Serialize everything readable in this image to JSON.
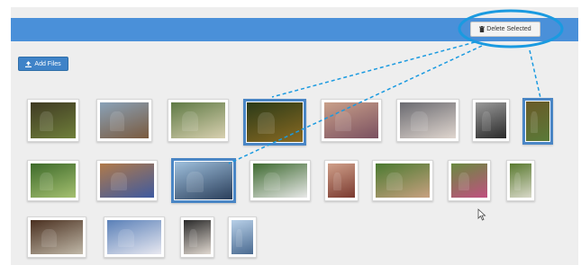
{
  "toolbar": {
    "delete_label": "Delete Selected",
    "delete_icon": "trash-icon",
    "add_label": "Add Files",
    "add_icon": "upload-icon"
  },
  "colors": {
    "accent": "#4a90d9",
    "selection_border": "#4a86c5",
    "callout": "#1a9ae0"
  },
  "gallery": {
    "rows": [
      {
        "photos": [
          {
            "name": "photo-1",
            "tone": [
              "#3f3a23",
              "#6f7f3a"
            ],
            "selected": false
          },
          {
            "name": "photo-2",
            "tone": [
              "#8aa2b8",
              "#7a5a3e"
            ],
            "selected": false
          },
          {
            "name": "photo-3",
            "tone": [
              "#5f7a45",
              "#d8d0b0"
            ],
            "selected": false
          },
          {
            "name": "photo-4",
            "tone": [
              "#2a3a18",
              "#8a6a22"
            ],
            "selected": true
          },
          {
            "name": "photo-5",
            "tone": [
              "#c9a08a",
              "#7a5060"
            ],
            "selected": false
          },
          {
            "name": "photo-6",
            "tone": [
              "#6a6a70",
              "#e0d6cf"
            ],
            "selected": false
          },
          {
            "name": "photo-7",
            "tone": [
              "#9a9a9a",
              "#2a2a2a"
            ],
            "selected": false
          },
          {
            "name": "photo-8",
            "tone": [
              "#6a5a28",
              "#5a7a38"
            ],
            "selected": true
          }
        ]
      },
      {
        "photos": [
          {
            "name": "photo-9",
            "tone": [
              "#3d6a2a",
              "#a5c070"
            ],
            "selected": false
          },
          {
            "name": "photo-10",
            "tone": [
              "#b07a4a",
              "#3e5aa0"
            ],
            "selected": false
          },
          {
            "name": "photo-11",
            "tone": [
              "#9fc0dd",
              "#2a3e5a"
            ],
            "selected": true
          },
          {
            "name": "photo-12",
            "tone": [
              "#3e6a30",
              "#e8e8e8"
            ],
            "selected": false
          },
          {
            "name": "photo-13",
            "tone": [
              "#d0a08a",
              "#7a3a30"
            ],
            "selected": false
          },
          {
            "name": "photo-14",
            "tone": [
              "#4a7a30",
              "#c8a080"
            ],
            "selected": false
          },
          {
            "name": "photo-15",
            "tone": [
              "#6a8a40",
              "#c05080"
            ],
            "selected": false
          },
          {
            "name": "photo-16",
            "tone": [
              "#5a7a30",
              "#d8d8c8"
            ],
            "selected": false
          }
        ]
      },
      {
        "photos": [
          {
            "name": "photo-17",
            "tone": [
              "#4a3020",
              "#c0b8a8"
            ],
            "selected": false
          },
          {
            "name": "photo-18",
            "tone": [
              "#5a80b8",
              "#e8e8f0"
            ],
            "selected": false
          },
          {
            "name": "photo-19",
            "tone": [
              "#2a2a2a",
              "#e0d8d0"
            ],
            "selected": false
          },
          {
            "name": "photo-20",
            "tone": [
              "#b8d0e8",
              "#4a6a90"
            ],
            "selected": false
          }
        ]
      }
    ]
  }
}
